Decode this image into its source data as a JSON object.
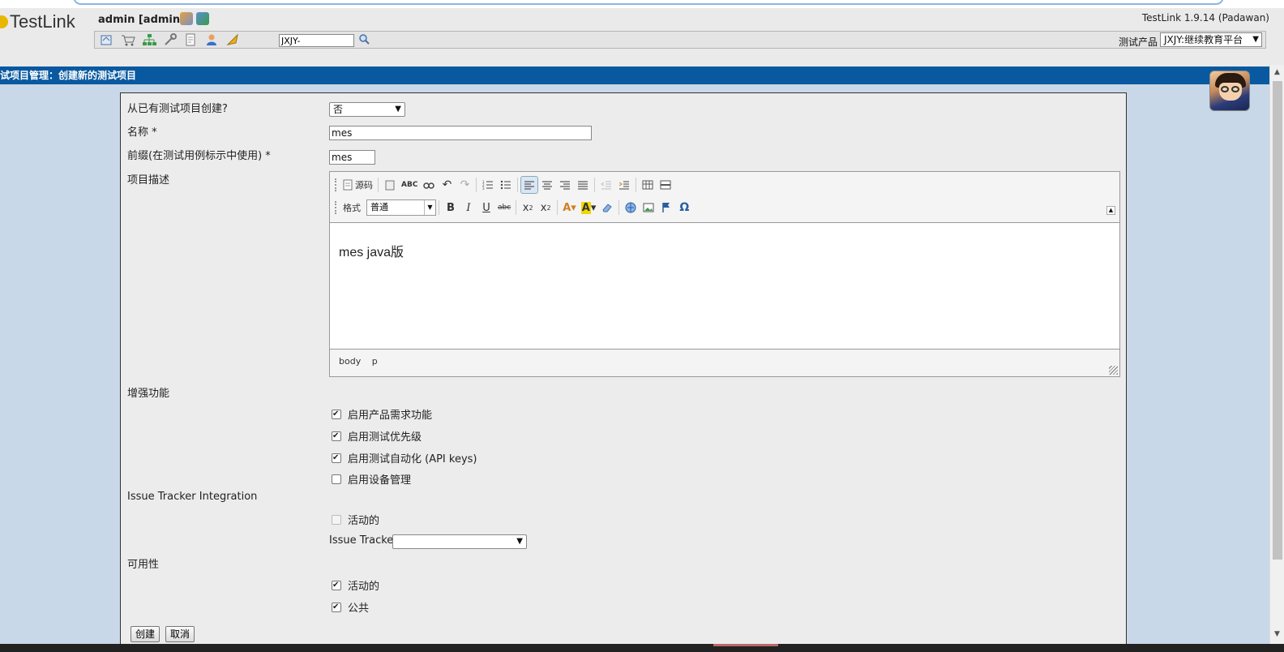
{
  "header": {
    "logo": "TestLink",
    "user": "admin [admin]",
    "version": "TestLink 1.9.14 (Padawan)",
    "search_value": "JXJY-",
    "product_label": "测试产品",
    "product_selected": "JXJY:继续教育平台"
  },
  "title_bar": {
    "text": "试项目管理：创建新的测试项目"
  },
  "form": {
    "copy_from_label": "从已有测试项目创建?",
    "copy_from_value": "否",
    "name_label": "名称 *",
    "name_value": "mes",
    "prefix_label": "前缀(在测试用例标示中使用) *",
    "prefix_value": "mes",
    "description_label": "项目描述",
    "editor": {
      "source_label": "源码",
      "format_label": "格式",
      "format_value": "普通",
      "content": "mes java版",
      "path": [
        "body",
        "p"
      ]
    },
    "features_label": "增强功能",
    "features": [
      {
        "label": "启用产品需求功能",
        "checked": true
      },
      {
        "label": "启用测试优先级",
        "checked": true
      },
      {
        "label": "启用测试自动化 (API keys)",
        "checked": true
      },
      {
        "label": "启用设备管理",
        "checked": false
      }
    ],
    "issue_tracker_section": "Issue Tracker Integration",
    "issue_tracker_active_label": "活动的",
    "issue_tracker_label": "Issue Tracker",
    "availability_label": "可用性",
    "availability": [
      {
        "label": "活动的",
        "checked": true
      },
      {
        "label": "公共",
        "checked": true
      }
    ],
    "create_button": "创建",
    "cancel_button": "取消"
  },
  "colors": {
    "title_bar": "#0859a0",
    "workspace": "#c8d8e8",
    "panel": "#ececec"
  }
}
